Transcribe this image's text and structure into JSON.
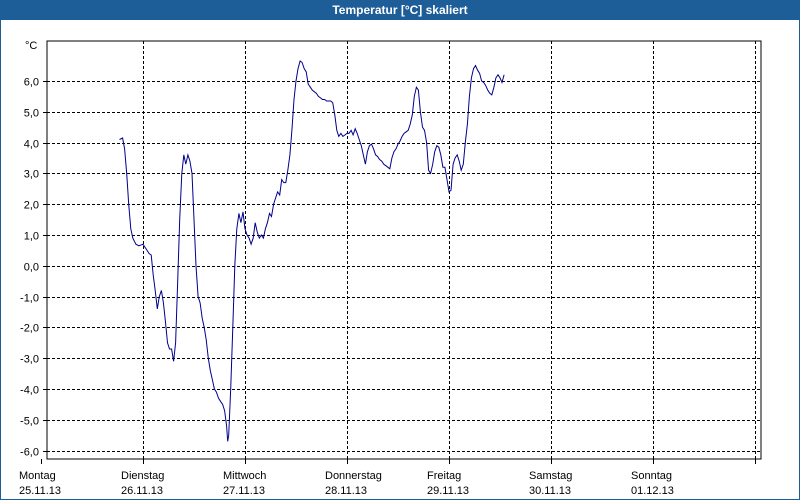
{
  "window": {
    "title": "Temperatur [°C] skaliert"
  },
  "colors": {
    "titlebar": "#1e5e98",
    "line": "#00008b",
    "grid": "#000000"
  },
  "chart_data": {
    "type": "line",
    "title": "Temperatur [°C] skaliert",
    "ylabel": "°C",
    "ylim": [
      -6.5,
      7.25
    ],
    "yticks": [
      6,
      5,
      4,
      3,
      2,
      1,
      0,
      -1,
      -2,
      -3,
      -4,
      -5,
      -6
    ],
    "ytick_labels": [
      "6,0",
      "5,0",
      "4,0",
      "3,0",
      "2,0",
      "1,0",
      "0,0",
      "-1,0",
      "-2,0",
      "-3,0",
      "-4,0",
      "-5,0",
      "-6,0"
    ],
    "xlim": [
      0,
      7
    ],
    "x_unit": "days from Montag 25.11.13",
    "xtick_labels": [
      {
        "day": "Montag",
        "date": "25.11.13"
      },
      {
        "day": "Dienstag",
        "date": "26.11.13"
      },
      {
        "day": "Mittwoch",
        "date": "27.11.13"
      },
      {
        "day": "Donnerstag",
        "date": "28.11.13"
      },
      {
        "day": "Freitag",
        "date": "29.11.13"
      },
      {
        "day": "Samstag",
        "date": "30.11.13"
      },
      {
        "day": "Sonntag",
        "date": "01.12.13"
      }
    ],
    "grid": true,
    "grid_style": "dashed",
    "series": [
      {
        "values": [
          [
            0.77,
            4.1
          ],
          [
            0.8,
            4.15
          ],
          [
            0.82,
            3.8
          ],
          [
            0.84,
            3.0
          ],
          [
            0.86,
            2.0
          ],
          [
            0.88,
            1.2
          ],
          [
            0.9,
            0.9
          ],
          [
            0.93,
            0.7
          ],
          [
            0.96,
            0.65
          ],
          [
            1.0,
            0.7
          ],
          [
            1.03,
            0.55
          ],
          [
            1.06,
            0.4
          ],
          [
            1.08,
            0.35
          ],
          [
            1.1,
            -0.3
          ],
          [
            1.12,
            -0.8
          ],
          [
            1.14,
            -1.4
          ],
          [
            1.16,
            -1.0
          ],
          [
            1.18,
            -0.8
          ],
          [
            1.2,
            -1.2
          ],
          [
            1.22,
            -1.8
          ],
          [
            1.24,
            -2.5
          ],
          [
            1.26,
            -2.7
          ],
          [
            1.28,
            -2.7
          ],
          [
            1.3,
            -3.1
          ],
          [
            1.32,
            -2.5
          ],
          [
            1.34,
            -0.5
          ],
          [
            1.36,
            1.5
          ],
          [
            1.38,
            3.0
          ],
          [
            1.4,
            3.6
          ],
          [
            1.42,
            3.3
          ],
          [
            1.44,
            3.6
          ],
          [
            1.46,
            3.4
          ],
          [
            1.48,
            3.0
          ],
          [
            1.5,
            1.5
          ],
          [
            1.52,
            0.0
          ],
          [
            1.54,
            -1.0
          ],
          [
            1.56,
            -1.2
          ],
          [
            1.58,
            -1.7
          ],
          [
            1.6,
            -2.0
          ],
          [
            1.62,
            -2.4
          ],
          [
            1.64,
            -3.0
          ],
          [
            1.66,
            -3.4
          ],
          [
            1.68,
            -3.7
          ],
          [
            1.7,
            -4.0
          ],
          [
            1.72,
            -4.1
          ],
          [
            1.74,
            -4.3
          ],
          [
            1.76,
            -4.4
          ],
          [
            1.78,
            -4.5
          ],
          [
            1.8,
            -4.7
          ],
          [
            1.82,
            -5.2
          ],
          [
            1.83,
            -5.7
          ],
          [
            1.84,
            -5.5
          ],
          [
            1.86,
            -4.0
          ],
          [
            1.88,
            -2.0
          ],
          [
            1.9,
            0.0
          ],
          [
            1.92,
            1.2
          ],
          [
            1.94,
            1.7
          ],
          [
            1.96,
            1.4
          ],
          [
            1.98,
            1.75
          ],
          [
            2.0,
            1.2
          ],
          [
            2.02,
            1.0
          ],
          [
            2.04,
            0.9
          ],
          [
            2.06,
            0.7
          ],
          [
            2.08,
            0.9
          ],
          [
            2.1,
            1.4
          ],
          [
            2.12,
            1.1
          ],
          [
            2.14,
            0.9
          ],
          [
            2.16,
            1.0
          ],
          [
            2.18,
            0.9
          ],
          [
            2.2,
            1.2
          ],
          [
            2.22,
            1.4
          ],
          [
            2.24,
            1.7
          ],
          [
            2.26,
            1.6
          ],
          [
            2.28,
            2.0
          ],
          [
            2.3,
            2.2
          ],
          [
            2.32,
            2.4
          ],
          [
            2.34,
            2.3
          ],
          [
            2.36,
            2.8
          ],
          [
            2.38,
            2.7
          ],
          [
            2.4,
            2.7
          ],
          [
            2.42,
            3.1
          ],
          [
            2.44,
            3.6
          ],
          [
            2.46,
            4.4
          ],
          [
            2.48,
            5.4
          ],
          [
            2.5,
            6.0
          ],
          [
            2.52,
            6.4
          ],
          [
            2.54,
            6.65
          ],
          [
            2.56,
            6.6
          ],
          [
            2.58,
            6.4
          ],
          [
            2.6,
            6.3
          ],
          [
            2.62,
            5.9
          ],
          [
            2.64,
            5.8
          ],
          [
            2.66,
            5.7
          ],
          [
            2.68,
            5.65
          ],
          [
            2.7,
            5.6
          ],
          [
            2.72,
            5.5
          ],
          [
            2.74,
            5.45
          ],
          [
            2.76,
            5.4
          ],
          [
            2.78,
            5.4
          ],
          [
            2.8,
            5.35
          ],
          [
            2.84,
            5.35
          ],
          [
            2.86,
            5.3
          ],
          [
            2.88,
            4.9
          ],
          [
            2.9,
            4.4
          ],
          [
            2.92,
            4.2
          ],
          [
            2.94,
            4.3
          ],
          [
            2.96,
            4.2
          ],
          [
            2.98,
            4.25
          ],
          [
            3.0,
            4.3
          ],
          [
            3.02,
            4.3
          ],
          [
            3.04,
            4.4
          ],
          [
            3.06,
            4.25
          ],
          [
            3.08,
            4.45
          ],
          [
            3.1,
            4.3
          ],
          [
            3.12,
            4.1
          ],
          [
            3.14,
            3.9
          ],
          [
            3.16,
            3.6
          ],
          [
            3.18,
            3.3
          ],
          [
            3.2,
            3.7
          ],
          [
            3.22,
            3.9
          ],
          [
            3.24,
            3.95
          ],
          [
            3.26,
            3.8
          ],
          [
            3.28,
            3.6
          ],
          [
            3.3,
            3.55
          ],
          [
            3.32,
            3.45
          ],
          [
            3.34,
            3.4
          ],
          [
            3.36,
            3.3
          ],
          [
            3.38,
            3.25
          ],
          [
            3.4,
            3.2
          ],
          [
            3.42,
            3.15
          ],
          [
            3.44,
            3.5
          ],
          [
            3.46,
            3.7
          ],
          [
            3.48,
            3.8
          ],
          [
            3.5,
            3.95
          ],
          [
            3.52,
            4.05
          ],
          [
            3.54,
            4.2
          ],
          [
            3.56,
            4.3
          ],
          [
            3.58,
            4.35
          ],
          [
            3.6,
            4.4
          ],
          [
            3.62,
            4.6
          ],
          [
            3.64,
            4.9
          ],
          [
            3.66,
            5.5
          ],
          [
            3.68,
            5.8
          ],
          [
            3.7,
            5.7
          ],
          [
            3.72,
            5.0
          ],
          [
            3.74,
            4.5
          ],
          [
            3.76,
            4.4
          ],
          [
            3.78,
            4.0
          ],
          [
            3.8,
            3.1
          ],
          [
            3.82,
            3.0
          ],
          [
            3.84,
            3.3
          ],
          [
            3.86,
            3.7
          ],
          [
            3.88,
            3.9
          ],
          [
            3.9,
            3.85
          ],
          [
            3.92,
            3.6
          ],
          [
            3.94,
            3.2
          ],
          [
            3.96,
            3.2
          ],
          [
            3.98,
            2.8
          ],
          [
            4.0,
            2.4
          ],
          [
            4.02,
            2.45
          ],
          [
            4.04,
            3.3
          ],
          [
            4.06,
            3.5
          ],
          [
            4.08,
            3.6
          ],
          [
            4.1,
            3.4
          ],
          [
            4.12,
            3.1
          ],
          [
            4.14,
            3.3
          ],
          [
            4.16,
            4.0
          ],
          [
            4.18,
            4.6
          ],
          [
            4.2,
            5.5
          ],
          [
            4.22,
            6.1
          ],
          [
            4.24,
            6.4
          ],
          [
            4.26,
            6.5
          ],
          [
            4.28,
            6.35
          ],
          [
            4.3,
            6.25
          ],
          [
            4.32,
            6.0
          ],
          [
            4.34,
            5.95
          ],
          [
            4.36,
            5.85
          ],
          [
            4.38,
            5.7
          ],
          [
            4.4,
            5.6
          ],
          [
            4.42,
            5.55
          ],
          [
            4.44,
            5.8
          ],
          [
            4.46,
            6.1
          ],
          [
            4.48,
            6.2
          ],
          [
            4.5,
            6.1
          ],
          [
            4.52,
            5.95
          ],
          [
            4.54,
            6.2
          ]
        ]
      }
    ]
  }
}
